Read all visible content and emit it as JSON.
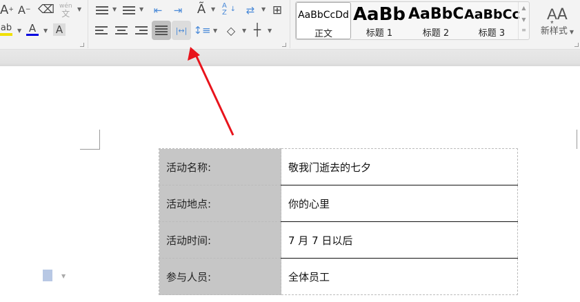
{
  "toolbar": {
    "font": {
      "grow": "A",
      "shrink": "A",
      "clear_format": "eraser",
      "phonetic_top": "wén",
      "phonetic_bottom": "文",
      "highlight": "ab",
      "font_color": "A",
      "char_shading": "A"
    },
    "paragraph": {
      "sort": "A Z"
    },
    "styles": [
      {
        "preview": "AaBbCcDd",
        "label": "正文",
        "selected": true
      },
      {
        "preview": "AaBb",
        "label": "标题 1"
      },
      {
        "preview": "AaBbC",
        "label": "标题 2"
      },
      {
        "preview": "AaBbCc",
        "label": "标题 3"
      }
    ],
    "new_style": "新样式",
    "colors": {
      "highlight": "#f0e000",
      "font_color": "#0000e0",
      "active": "#c0c0c0",
      "annotation": "#e8141c"
    }
  },
  "table": {
    "rows": [
      {
        "key": "活动名称:",
        "value": "敬我门逝去的七夕"
      },
      {
        "key": "活动地点:",
        "value": "你的心里"
      },
      {
        "key": "活动时间:",
        "value": "7 月 7 日以后"
      },
      {
        "key": "参与人员:",
        "value": "全体员工"
      }
    ]
  }
}
